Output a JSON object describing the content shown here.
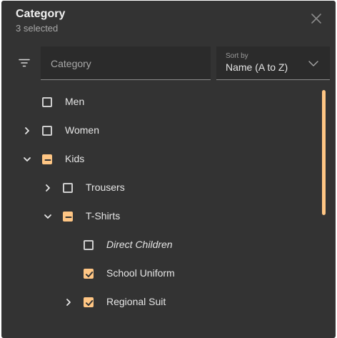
{
  "dialog": {
    "title": "Category",
    "subtitle": "3 selected"
  },
  "search": {
    "placeholder": "Category",
    "value": ""
  },
  "sort": {
    "label": "Sort by",
    "value": "Name (A to Z)"
  },
  "tree": [
    {
      "label": "Men",
      "level": 0,
      "expander": "none",
      "state": "unchecked",
      "italic": false
    },
    {
      "label": "Women",
      "level": 0,
      "expander": "collapsed",
      "state": "unchecked",
      "italic": false
    },
    {
      "label": "Kids",
      "level": 0,
      "expander": "expanded",
      "state": "indeterminate",
      "italic": false
    },
    {
      "label": "Trousers",
      "level": 1,
      "expander": "collapsed",
      "state": "unchecked",
      "italic": false
    },
    {
      "label": "T-Shirts",
      "level": 1,
      "expander": "expanded",
      "state": "indeterminate",
      "italic": false
    },
    {
      "label": "Direct Children",
      "level": 2,
      "expander": "none",
      "state": "unchecked",
      "italic": true
    },
    {
      "label": "School Uniform",
      "level": 2,
      "expander": "none",
      "state": "checked",
      "italic": false
    },
    {
      "label": "Regional Suit",
      "level": 2,
      "expander": "collapsed",
      "state": "checked",
      "italic": false
    }
  ],
  "colors": {
    "accent": "#ffc684",
    "background": "#333333",
    "field": "#2b2b2b"
  },
  "icons": {
    "close": "close-icon",
    "filter": "filter-list-icon",
    "sort_dropdown": "chevron-down-icon",
    "expand": "chevron-right-icon",
    "collapse": "chevron-down-icon"
  }
}
